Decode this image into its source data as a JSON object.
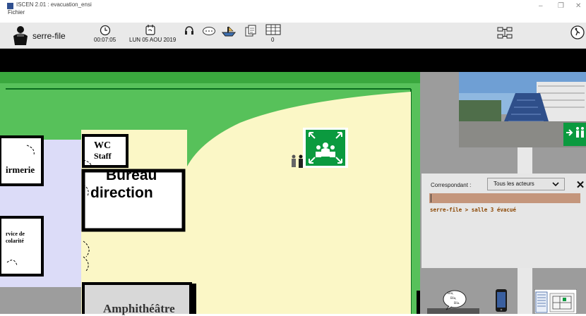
{
  "window": {
    "title": "ISCEN 2.01 : evacuation_ensi",
    "menu": "Fichier",
    "minimize": "–",
    "maximize": "❐",
    "close": "✕"
  },
  "toolbar": {
    "actor_role": "serre-file",
    "clock": "00:07:05",
    "date": "LUN 05 AOU 2019",
    "counter_label": "00",
    "counter_value": "0",
    "icons": [
      "person-icon",
      "clock-icon",
      "calendar-icon",
      "headset-icon",
      "speech-icon",
      "boat-icon",
      "documents-icon",
      "calendar-grid-icon",
      "network-icon",
      "exit-icon"
    ]
  },
  "map": {
    "rooms": {
      "wc": "WC",
      "wc2": "Staff",
      "infirmerie": "irmerie",
      "bureau1": "Bureau",
      "bureau2": "direction",
      "scolarite1": "rvice de",
      "scolarite2": "colarité",
      "amphi": "Amphithéâtre"
    },
    "colors": {
      "lawn": "#57c15a",
      "courtyard": "#fbf7c6",
      "corridor": "#dcdcf8",
      "assembly": "#0b9a3f"
    }
  },
  "chat": {
    "correspondant_label": "Correspondant :",
    "selected": "Tous les acteurs",
    "close": "✕",
    "message": "serre-file > salle 3 évacué"
  },
  "bottom": {
    "speech_bubble": [
      "Bla,",
      "Bla,",
      "Bla."
    ]
  }
}
